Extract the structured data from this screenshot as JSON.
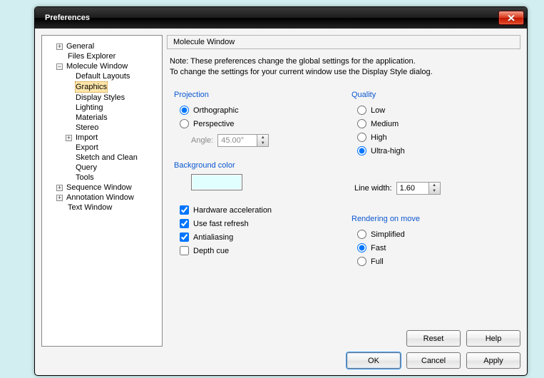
{
  "window": {
    "title": "Preferences"
  },
  "tree": {
    "general": "General",
    "filesExplorer": "Files Explorer",
    "moleculeWindow": "Molecule Window",
    "defaultLayouts": "Default Layouts",
    "graphics": "Graphics",
    "displayStyles": "Display Styles",
    "lighting": "Lighting",
    "materials": "Materials",
    "stereo": "Stereo",
    "import": "Import",
    "export": "Export",
    "sketchAndClean": "Sketch and Clean",
    "query": "Query",
    "tools": "Tools",
    "sequenceWindow": "Sequence Window",
    "annotationWindow": "Annotation Window",
    "textWindow": "Text Window"
  },
  "panel": {
    "heading": "Molecule Window",
    "noteLine1": "Note: These preferences change the global settings for the application.",
    "noteLine2": "To change the settings for your current window use the Display Style dialog.",
    "projection": {
      "title": "Projection",
      "orthographic": "Orthographic",
      "perspective": "Perspective",
      "angleLabel": "Angle:",
      "angleValue": "45.00°"
    },
    "backgroundColor": {
      "title": "Background color",
      "value": "#e1ffff"
    },
    "checks": {
      "hardwareAccel": "Hardware acceleration",
      "fastRefresh": "Use fast refresh",
      "antialiasing": "Antialiasing",
      "depthCue": "Depth cue"
    },
    "quality": {
      "title": "Quality",
      "low": "Low",
      "medium": "Medium",
      "high": "High",
      "ultraHigh": "Ultra-high"
    },
    "lineWidth": {
      "label": "Line width:",
      "value": "1.60"
    },
    "renderingOnMove": {
      "title": "Rendering on move",
      "simplified": "Simplified",
      "fast": "Fast",
      "full": "Full"
    },
    "buttons": {
      "reset": "Reset",
      "help": "Help",
      "ok": "OK",
      "cancel": "Cancel",
      "apply": "Apply"
    }
  }
}
